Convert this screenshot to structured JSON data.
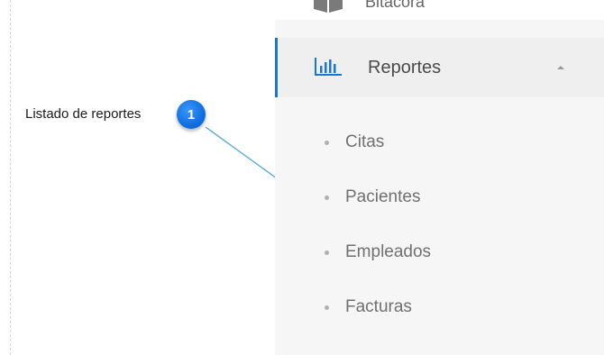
{
  "annotation": {
    "label": "Listado de reportes",
    "badge_number": "1",
    "badge_color": "#1273e6"
  },
  "sidebar": {
    "previous_item": {
      "label": "Bitácora",
      "icon": "book-icon"
    },
    "reportes": {
      "label": "Reportes",
      "icon": "bar-chart-icon",
      "expanded": true,
      "accent_color": "#1976d2",
      "children": [
        {
          "label": "Citas"
        },
        {
          "label": "Pacientes"
        },
        {
          "label": "Empleados"
        },
        {
          "label": "Facturas"
        }
      ]
    }
  }
}
